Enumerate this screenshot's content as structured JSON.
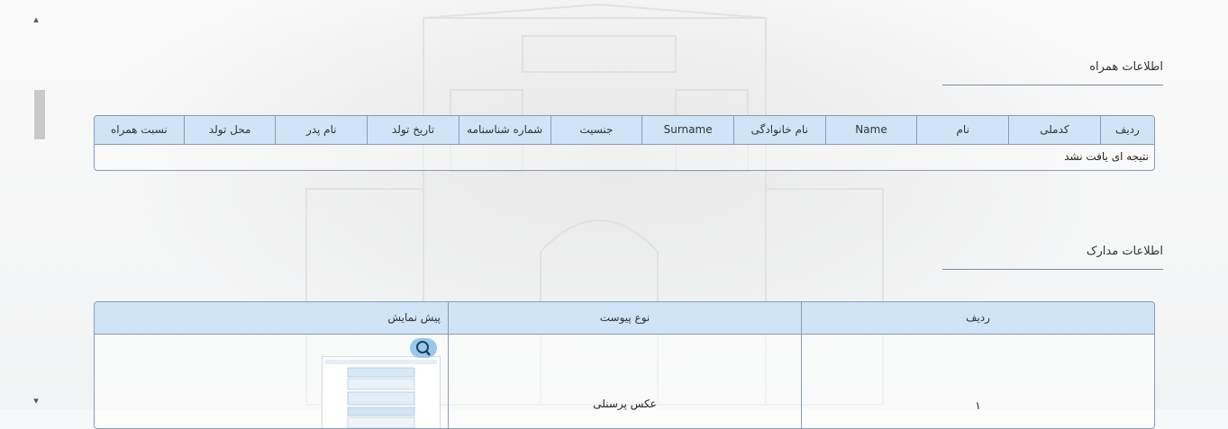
{
  "scroll": {
    "up_icon": "▴",
    "down_icon": "▾"
  },
  "companions": {
    "title": "اطلاعات همراه",
    "columns": [
      "ردیف",
      "کدملی",
      "نام",
      "Name",
      "نام خانوادگی",
      "Surname",
      "جنسیت",
      "شماره شناسنامه",
      "تاریخ تولد",
      "نام پدر",
      "محل تولد",
      "نسبت همراه"
    ],
    "empty_message": "نتیجه ای یافت نشد"
  },
  "documents": {
    "title": "اطلاعات مدارک",
    "columns": [
      "ردیف",
      "نوع پیوست",
      "پیش نمایش"
    ],
    "rows": [
      {
        "num": "۱",
        "type": "عکس پرسنلی"
      }
    ],
    "preview_icon": "magnifier-icon"
  },
  "colors": {
    "header_bg": "#cfe4f7",
    "border": "#8a9bb0",
    "zoom_button": "#9bc8ea"
  }
}
